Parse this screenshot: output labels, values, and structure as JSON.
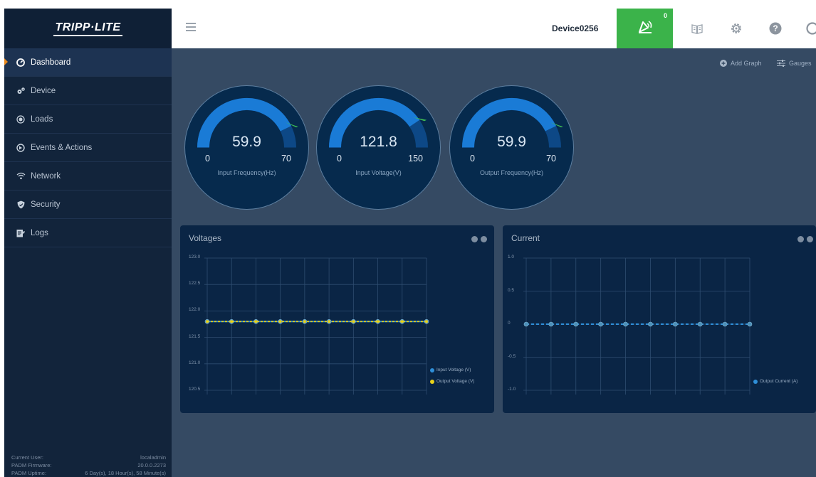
{
  "brand": {
    "logo_text": "TRIPP·LITE"
  },
  "sidebar": {
    "items": [
      {
        "label": "Dashboard",
        "icon": "dashboard-icon",
        "active": true
      },
      {
        "label": "Device",
        "icon": "gears-icon"
      },
      {
        "label": "Loads",
        "icon": "loads-icon"
      },
      {
        "label": "Events & Actions",
        "icon": "events-icon"
      },
      {
        "label": "Network",
        "icon": "wifi-icon"
      },
      {
        "label": "Security",
        "icon": "shield-icon"
      },
      {
        "label": "Logs",
        "icon": "logs-icon"
      }
    ],
    "footer": {
      "user_label": "Current User:",
      "user_value": "localadmin",
      "firmware_label": "PADM Firmware:",
      "firmware_value": "20.0.0.2273",
      "uptime_label": "PADM Uptime:",
      "uptime_value": "6 Day(s), 18 Hour(s), 58 Minute(s)"
    }
  },
  "header": {
    "device_name": "Device0256",
    "alarm_count": "0",
    "icons": [
      "menu-icon",
      "alarm-icon",
      "book-icon",
      "settings-icon",
      "help-icon",
      "user-icon"
    ],
    "accent_color": "#3bb34a"
  },
  "toolbar": {
    "add_graph_label": "Add Graph",
    "gauges_label": "Gauges"
  },
  "gauges": [
    {
      "value": "59.9",
      "min": "0",
      "max": "70",
      "label": "Input Frequency(Hz)",
      "fraction": 0.856
    },
    {
      "value": "121.8",
      "min": "0",
      "max": "150",
      "label": "Input Voltage(V)",
      "fraction": 0.812
    },
    {
      "value": "59.9",
      "min": "0",
      "max": "70",
      "label": "Output Frequency(Hz)",
      "fraction": 0.856
    }
  ],
  "panels": {
    "voltages": {
      "title": "Voltages"
    },
    "current": {
      "title": "Current"
    }
  },
  "chart_data": [
    {
      "type": "line",
      "title": "Voltages",
      "y_ticks": [
        "123.0",
        "122.5",
        "122.0",
        "121.5",
        "121.0",
        "120.5"
      ],
      "ylim": [
        120.5,
        123.0
      ],
      "point_count": 10,
      "series": [
        {
          "name": "Input Voltage (V)",
          "color": "#2f8fd8",
          "values": [
            121.8,
            121.8,
            121.8,
            121.8,
            121.8,
            121.8,
            121.8,
            121.8,
            121.8,
            121.8
          ]
        },
        {
          "name": "Output Voltage (V)",
          "color": "#e8d21a",
          "values": [
            121.8,
            121.8,
            121.8,
            121.8,
            121.8,
            121.8,
            121.8,
            121.8,
            121.8,
            121.8
          ]
        }
      ],
      "grid": true,
      "legend_position": "bottom-right"
    },
    {
      "type": "line",
      "title": "Current",
      "y_ticks": [
        "1.0",
        "0.5",
        "0",
        "-0.5",
        "-1.0"
      ],
      "ylim": [
        -1.0,
        1.0
      ],
      "point_count": 10,
      "series": [
        {
          "name": "Output Current (A)",
          "color": "#2f8fd8",
          "values": [
            0,
            0,
            0,
            0,
            0,
            0,
            0,
            0,
            0,
            0
          ]
        }
      ],
      "grid": true,
      "legend_position": "bottom-right"
    }
  ]
}
